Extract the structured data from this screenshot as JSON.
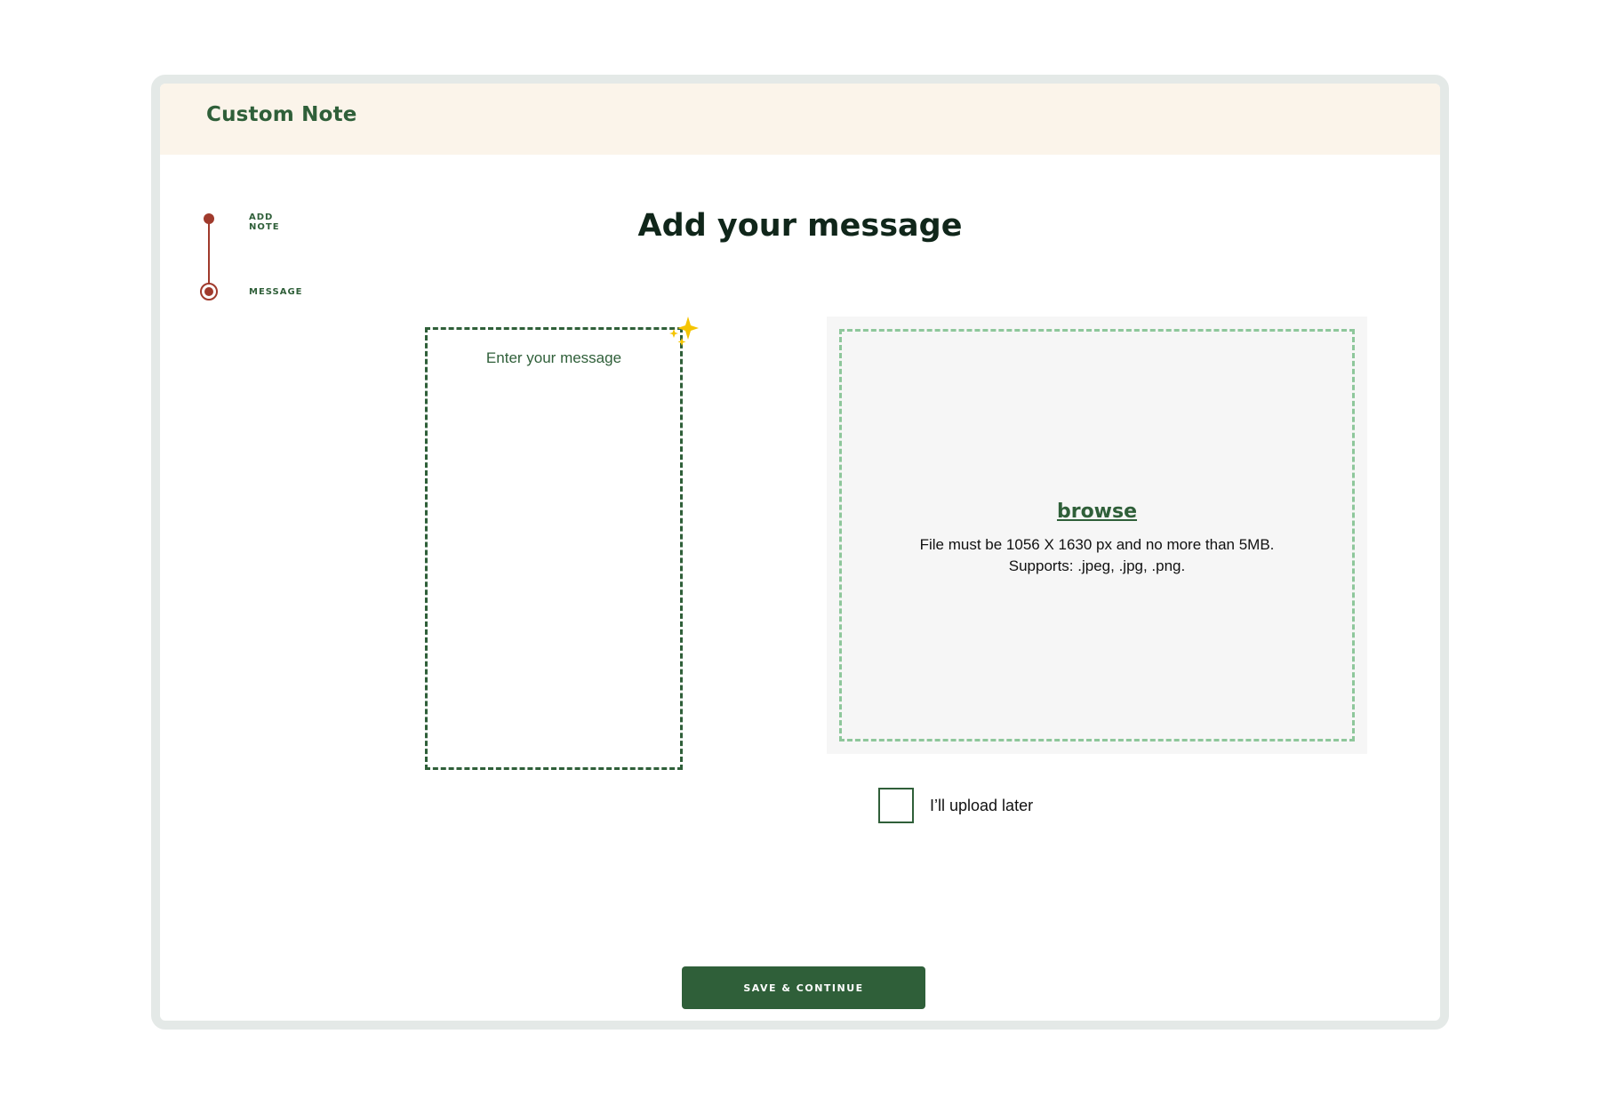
{
  "header": {
    "title": "Custom Note"
  },
  "stepper": {
    "steps": [
      {
        "label": "ADD NOTE"
      },
      {
        "label": "MESSAGE"
      }
    ]
  },
  "main": {
    "title": "Add your message",
    "message_card": {
      "placeholder": "Enter your message"
    },
    "upload": {
      "browse_label": "browse",
      "requirements_line1": "File must be 1056 X 1630 px and no more than 5MB.",
      "requirements_line2": "Supports: .jpeg, .jpg, .png."
    },
    "upload_later": {
      "label": "I’ll upload later",
      "checked": false
    }
  },
  "footer": {
    "save_label": "SAVE & CONTINUE"
  },
  "colors": {
    "brand_green": "#2f5f39",
    "step_accent": "#a03a2c",
    "header_bg": "#fbf4ea",
    "sparkle": "#f5c400",
    "upload_dash": "#8ec79b"
  },
  "icons": {
    "sparkle": "sparkle-icon"
  }
}
